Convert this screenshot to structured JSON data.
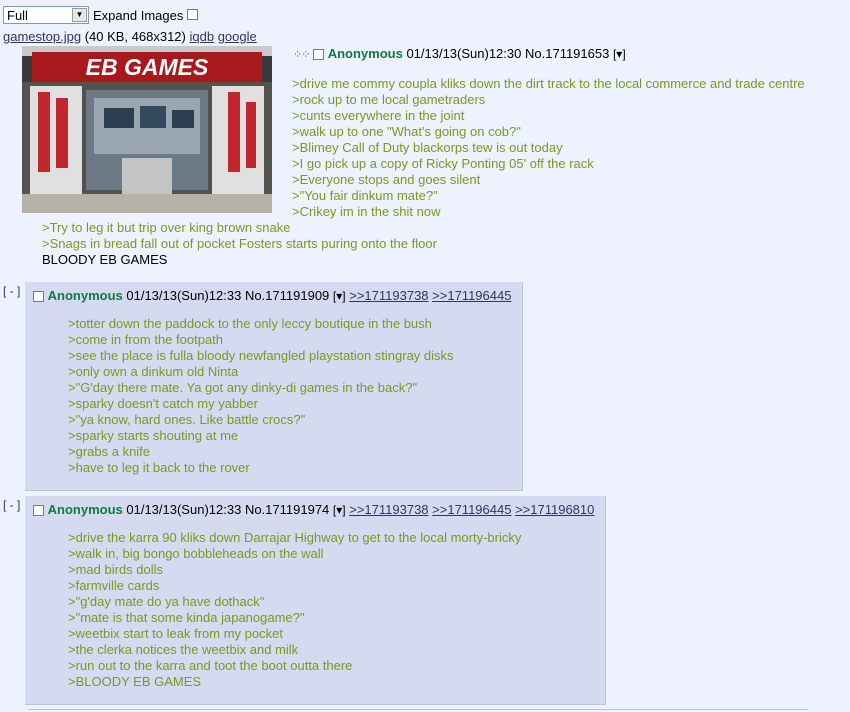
{
  "controls": {
    "image_mode_select": "Full",
    "expand_images_label": "Expand Images"
  },
  "op": {
    "file": {
      "name": "gamestop.jpg",
      "info": "(40 KB, 468x312)",
      "iqdb_label": "iqdb",
      "google_label": "google"
    },
    "thumb_sign": "EB GAMES",
    "name": "Anonymous",
    "date": "01/13/13(Sun)12:30",
    "number": "No.171191653",
    "menu_label": "[▾]",
    "lines_beside_image": [
      ">drive me commy coupla kliks down the dirt track to the local commerce and trade centre",
      ">rock up to me local gametraders",
      ">cunts everywhere in the joint",
      ">walk up to one \"What's going on cob?\"",
      ">Blimey Call of Duty blackorps tew is out today",
      ">I go pick up a copy of Ricky Ponting 05' off the rack",
      ">Everyone stops and goes silent",
      ">\"You fair dinkum mate?\"",
      ">Crikey im in the shit now"
    ],
    "lines_below_image": [
      ">Try to leg it but trip over king brown snake",
      ">Snags in bread fall out of pocket Fosters starts puring onto the floor"
    ],
    "final_line": "BLOODY EB GAMES"
  },
  "replies": [
    {
      "collapse_label": "[ - ]",
      "name": "Anonymous",
      "date": "01/13/13(Sun)12:33",
      "number": "No.171191909",
      "menu_label": "[▾]",
      "backlinks": [
        ">>171193738",
        ">>171196445"
      ],
      "lines": [
        ">totter down the paddock to the only leccy boutique in the bush",
        ">come in from the footpath",
        ">see the place is fulla bloody newfangled playstation stingray disks",
        ">only own a dinkum old Ninta",
        ">\"G'day there mate. Ya got any dinky-di games in the back?\"",
        ">sparky doesn't catch my yabber",
        ">\"ya know, hard ones. Like battle crocs?\"",
        ">sparky starts shouting at me",
        ">grabs a knife",
        ">have to leg it back to the rover"
      ]
    },
    {
      "collapse_label": "[ - ]",
      "name": "Anonymous",
      "date": "01/13/13(Sun)12:33",
      "number": "No.171191974",
      "menu_label": "[▾]",
      "backlinks": [
        ">>171193738",
        ">>171196445",
        ">>171196810"
      ],
      "lines": [
        ">drive the karra 90 kliks down Darrajar Highway to get to the local morty-bricky",
        ">walk in, big bongo bobbleheads on the wall",
        ">mad birds dolls",
        ">farmville cards",
        ">\"g'day mate do ya have dothack\"",
        ">\"mate is that some kinda japanogame?\"",
        ">weetbix start to leak from my pocket",
        ">the clerka notices the weetbix and milk",
        ">run out to the karra and toot the boot outta there",
        ">BLOODY EB GAMES"
      ]
    }
  ],
  "colors": {
    "page_bg": "#eef2ff",
    "reply_bg": "#d6daf0",
    "greentext": "#789922",
    "name": "#117743",
    "link": "#34345c"
  }
}
